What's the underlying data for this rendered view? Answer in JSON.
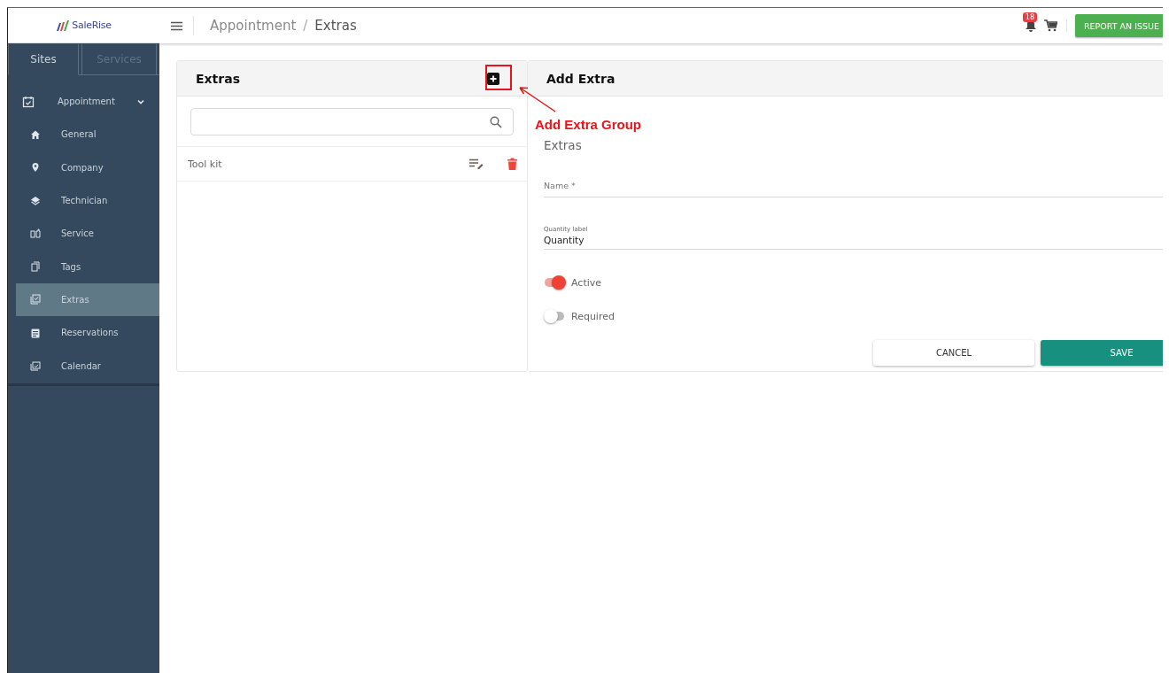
{
  "logo": {
    "text": "SaleRise"
  },
  "topbar": {
    "breadcrumb": [
      "Appointment",
      "Extras"
    ],
    "separator": "/",
    "notification_count": "18",
    "report_button": "REPORT AN ISSUE"
  },
  "sidebar": {
    "tabs": [
      {
        "label": "Sites",
        "selected": true
      },
      {
        "label": "Services",
        "selected": false
      }
    ],
    "items": [
      {
        "label": "Appointment",
        "expanded": true,
        "selected": false,
        "children": [
          {
            "label": "General",
            "selected": false
          },
          {
            "label": "Company",
            "selected": false
          },
          {
            "label": "Technician",
            "selected": false
          },
          {
            "label": "Service",
            "selected": false
          },
          {
            "label": "Tags",
            "selected": false
          },
          {
            "label": "Extras",
            "selected": true
          },
          {
            "label": "Reservations",
            "selected": false
          },
          {
            "label": "Calendar",
            "selected": false
          }
        ]
      }
    ]
  },
  "list_panel": {
    "title": "Extras",
    "rows": [
      {
        "label": "Tool kit"
      }
    ]
  },
  "form_panel": {
    "title": "Add Extra",
    "form_title": "Extras",
    "fields": [
      {
        "label": "Name *"
      },
      {
        "label": "Quantity label",
        "value": "Quantity"
      }
    ],
    "toggles": [
      {
        "label": "Active",
        "on": true
      },
      {
        "label": "Required",
        "on": false
      }
    ],
    "buttons": [
      {
        "label": "CANCEL",
        "kind": "secondary"
      },
      {
        "label": "SAVE",
        "kind": "primary"
      }
    ]
  },
  "annotation": {
    "label": "Add Extra Group"
  }
}
